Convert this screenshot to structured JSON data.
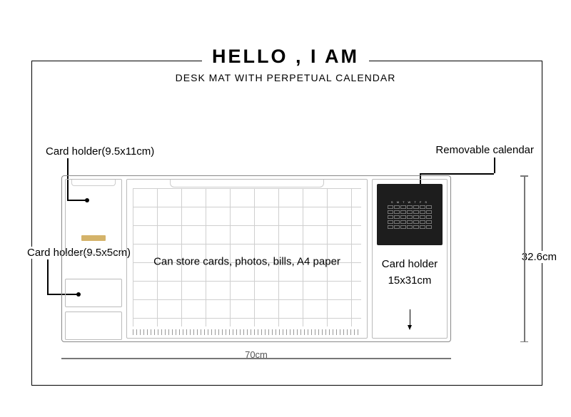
{
  "title": "HELLO , I AM",
  "subtitle": "DESK MAT WITH PERPETUAL CALENDAR",
  "labels": {
    "card_holder_top": "Card holder(9.5x11cm)",
    "card_holder_small": "Card holder(9.5x5cm)",
    "removable_calendar": "Removable calendar",
    "center_note": "Can store cards, photos, bills, A4 paper",
    "right_card_holder_line1": "Card holder",
    "right_card_holder_line2": "15x31cm"
  },
  "dimensions": {
    "width": "70cm",
    "height": "32.6cm"
  },
  "calendar_header": "S M T W T F S"
}
